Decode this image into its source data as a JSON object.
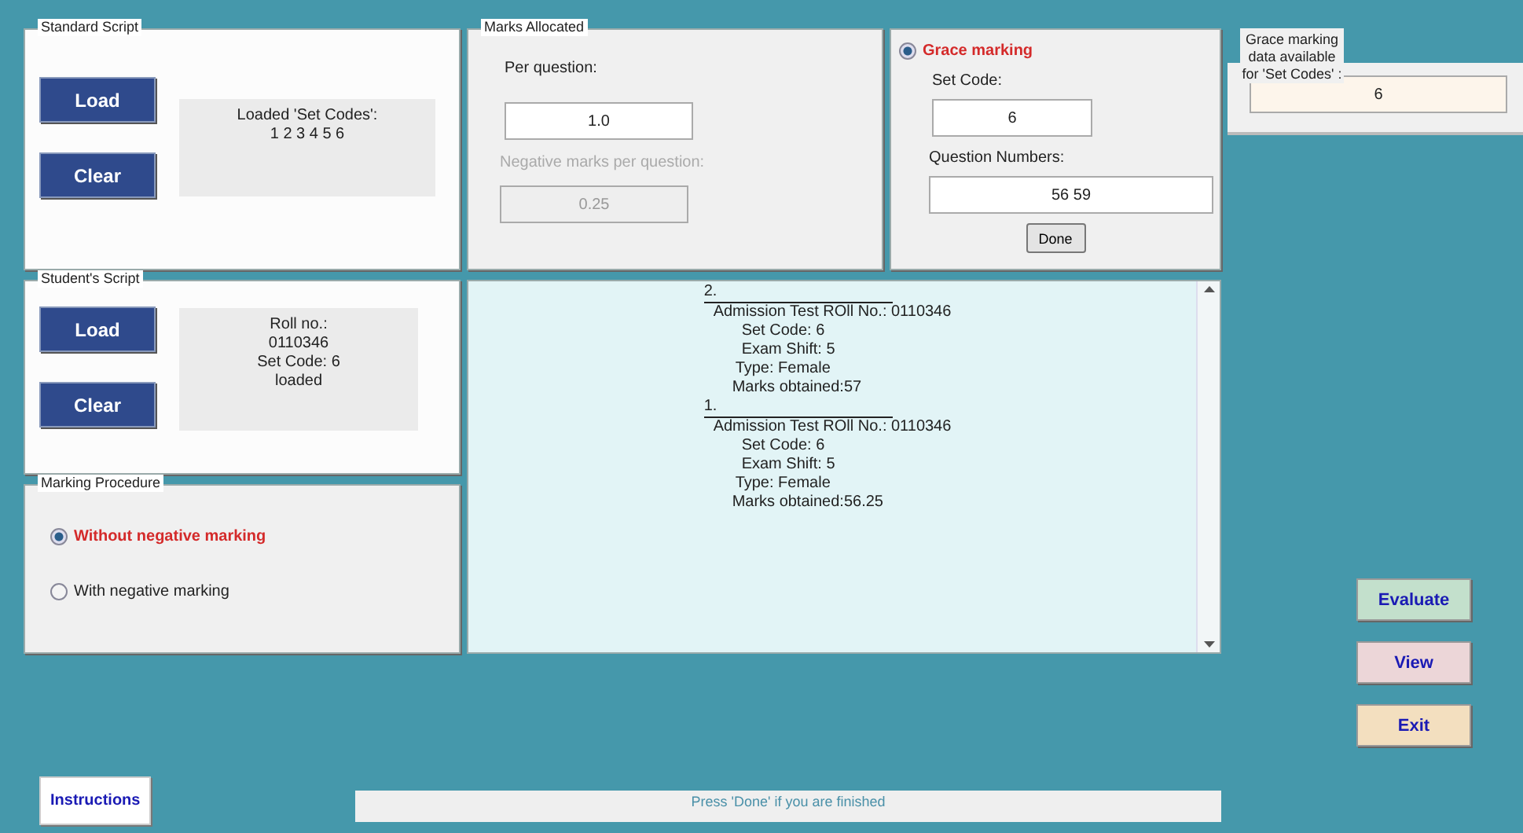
{
  "standard_script": {
    "title": "Standard Script",
    "buttons": [
      "Load",
      "Clear"
    ],
    "info": [
      "Loaded 'Set Codes':",
      "1 2 3 4 5 6"
    ]
  },
  "marks_allocated": {
    "title": "Marks Allocated",
    "per_question": {
      "label": "Per question:",
      "value": "1.0",
      "disabled": false
    },
    "negative": {
      "label": "Negative marks per question:",
      "value": "0.25",
      "disabled": true
    }
  },
  "grace_marking": {
    "label": "Grace marking",
    "selected": true,
    "set_code": {
      "label": "Set Code:",
      "value": "6"
    },
    "question_numbers": {
      "label": "Question Numbers:",
      "value": "56 59"
    },
    "done_button": "Done"
  },
  "grace_data": {
    "label": "Grace marking data available for 'Set Codes' :",
    "value": "6"
  },
  "students_script": {
    "title": "Student's Script",
    "buttons": [
      "Load",
      "Clear"
    ],
    "info": [
      "Roll no.:",
      "0110346",
      "Set Code: 6",
      "loaded"
    ]
  },
  "log": {
    "entries": [
      {
        "index": "2.",
        "lines": [
          "Admission Test ROll No.: 0110346",
          "Set Code: 6",
          "Exam Shift: 5",
          "Type: Female",
          "Marks obtained:57"
        ]
      },
      {
        "index": "1.",
        "lines": [
          "Admission Test ROll No.: 0110346",
          "Set Code: 6",
          "Exam Shift: 5",
          "Type: Female",
          "Marks obtained:56.25"
        ]
      }
    ]
  },
  "marking_procedure": {
    "title": "Marking Procedure",
    "options": [
      {
        "label": "Without negative marking",
        "selected": true
      },
      {
        "label": "With negative marking",
        "selected": false
      }
    ]
  },
  "actions": [
    {
      "label": "Evaluate",
      "color": "#c3e0cc"
    },
    {
      "label": "View",
      "color": "#ecd6d8"
    },
    {
      "label": "Exit",
      "color": "#f3dfbf"
    }
  ],
  "instructions_button": "Instructions",
  "status_message": "Press 'Done' if you are finished"
}
